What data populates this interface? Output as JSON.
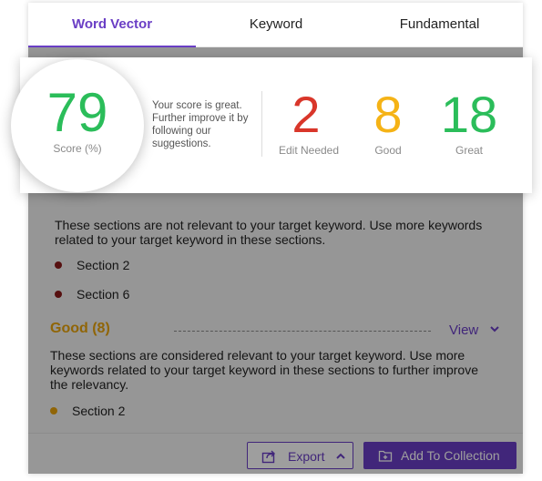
{
  "tabs": [
    {
      "label": "Word Vector",
      "active": true
    },
    {
      "label": "Keyword",
      "active": false
    },
    {
      "label": "Fundamental",
      "active": false
    }
  ],
  "score": {
    "value": "79",
    "label": "Score (%)",
    "message": "Your score is great. Further improve it by following our suggestions."
  },
  "stats": [
    {
      "value": "2",
      "label": "Edit Needed",
      "color": "#d9362a"
    },
    {
      "value": "8",
      "label": "Good",
      "color": "#f5b316"
    },
    {
      "value": "18",
      "label": "Great",
      "color": "#2bbd5a"
    }
  ],
  "edit_needed": {
    "description": "These sections are not relevant to your target keyword. Use more keywords related to your target keyword in these sections.",
    "items": [
      "Section 2",
      "Section 6"
    ],
    "dot_color": "#8b1a1a"
  },
  "good": {
    "title": "Good (8)",
    "view_label": "View",
    "description": "These sections are considered relevant to your target keyword. Use more keywords related to your target keyword in these sections to further improve the relevancy.",
    "items": [
      "Section 2"
    ],
    "dot_color": "#e8a40c"
  },
  "footer": {
    "export_label": "Export",
    "add_label": "Add To Collection"
  },
  "colors": {
    "accent": "#6a3ec5",
    "great": "#2bbd5a",
    "good": "#f5b316",
    "edit": "#d9362a"
  },
  "icons": [
    "export-icon",
    "chevron-up-icon",
    "chevron-down-icon",
    "add-collection-icon"
  ]
}
